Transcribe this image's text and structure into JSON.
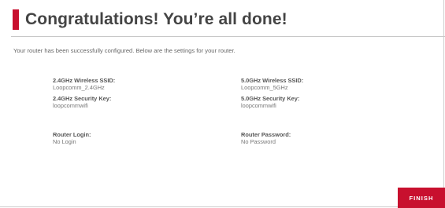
{
  "header": {
    "title": "Congratulations! You’re all done!"
  },
  "intro": "Your router has been successfully configured. Below are the settings for your router.",
  "settings": {
    "ssid_24": {
      "label": "2.4GHz Wireless SSID:",
      "value": "Loopcomm_2.4GHz"
    },
    "ssid_50": {
      "label": "5.0GHz Wireless SSID:",
      "value": "Loopcomm_5GHz"
    },
    "key_24": {
      "label": "2.4GHz Security Key:",
      "value": "loopcommwifi"
    },
    "key_50": {
      "label": "5.0GHz Security Key:",
      "value": "loopcommwifi"
    },
    "login": {
      "label": "Router Login:",
      "value": "No Login"
    },
    "password": {
      "label": "Router Password:",
      "value": "No Password"
    }
  },
  "actions": {
    "finish_label": "FINISH"
  },
  "colors": {
    "accent": "#c8102e"
  }
}
